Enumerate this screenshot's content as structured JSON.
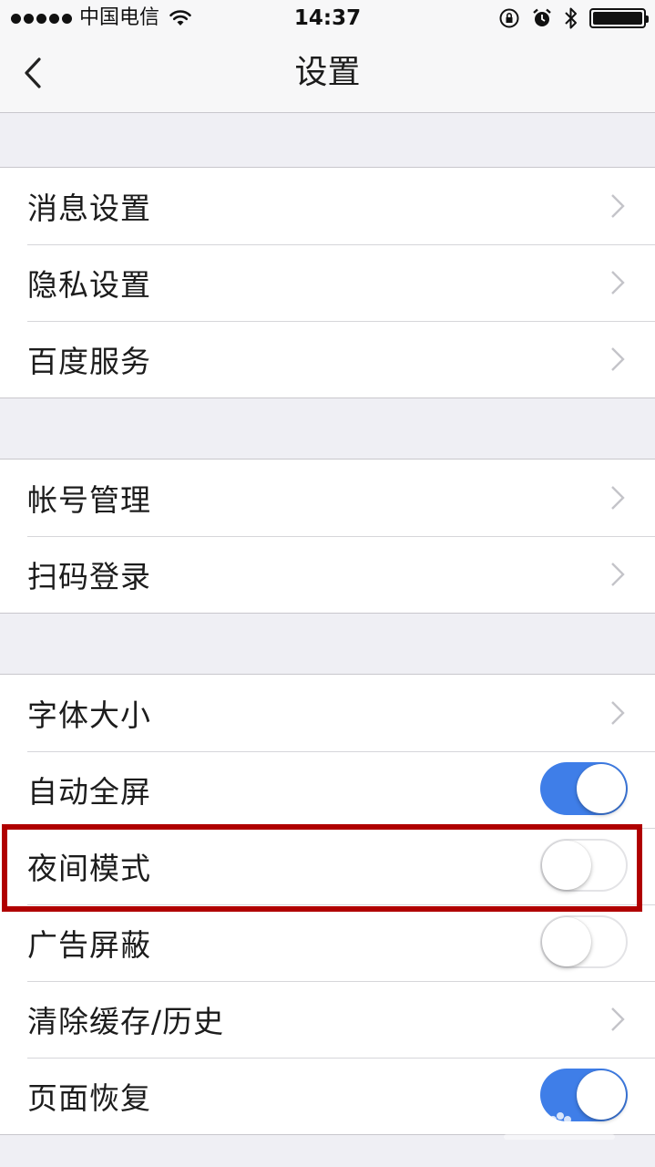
{
  "status_bar": {
    "carrier": "中国电信",
    "time": "14:37",
    "icons": [
      "signal-dots-icon",
      "wifi-icon",
      "rotation-lock-icon",
      "alarm-icon",
      "bluetooth-icon",
      "battery-icon"
    ]
  },
  "navbar": {
    "title": "设置",
    "back_icon": "chevron-left-icon"
  },
  "groups": [
    {
      "items": [
        {
          "label": "消息设置",
          "type": "link"
        },
        {
          "label": "隐私设置",
          "type": "link"
        },
        {
          "label": "百度服务",
          "type": "link"
        }
      ]
    },
    {
      "items": [
        {
          "label": "帐号管理",
          "type": "link"
        },
        {
          "label": "扫码登录",
          "type": "link"
        }
      ]
    },
    {
      "items": [
        {
          "label": "字体大小",
          "type": "link"
        },
        {
          "label": "自动全屏",
          "type": "toggle",
          "on": true
        },
        {
          "label": "夜间模式",
          "type": "toggle",
          "on": false
        },
        {
          "label": "广告屏蔽",
          "type": "toggle",
          "on": false
        },
        {
          "label": "清除缓存/历史",
          "type": "link"
        },
        {
          "label": "页面恢复",
          "type": "toggle",
          "on": true
        }
      ]
    }
  ],
  "colors": {
    "toggle_on": "#3f7ee8",
    "highlight": "#b00000",
    "background": "#efeff4"
  },
  "watermark": {
    "icon": "baidu-paw-watermark-icon"
  }
}
